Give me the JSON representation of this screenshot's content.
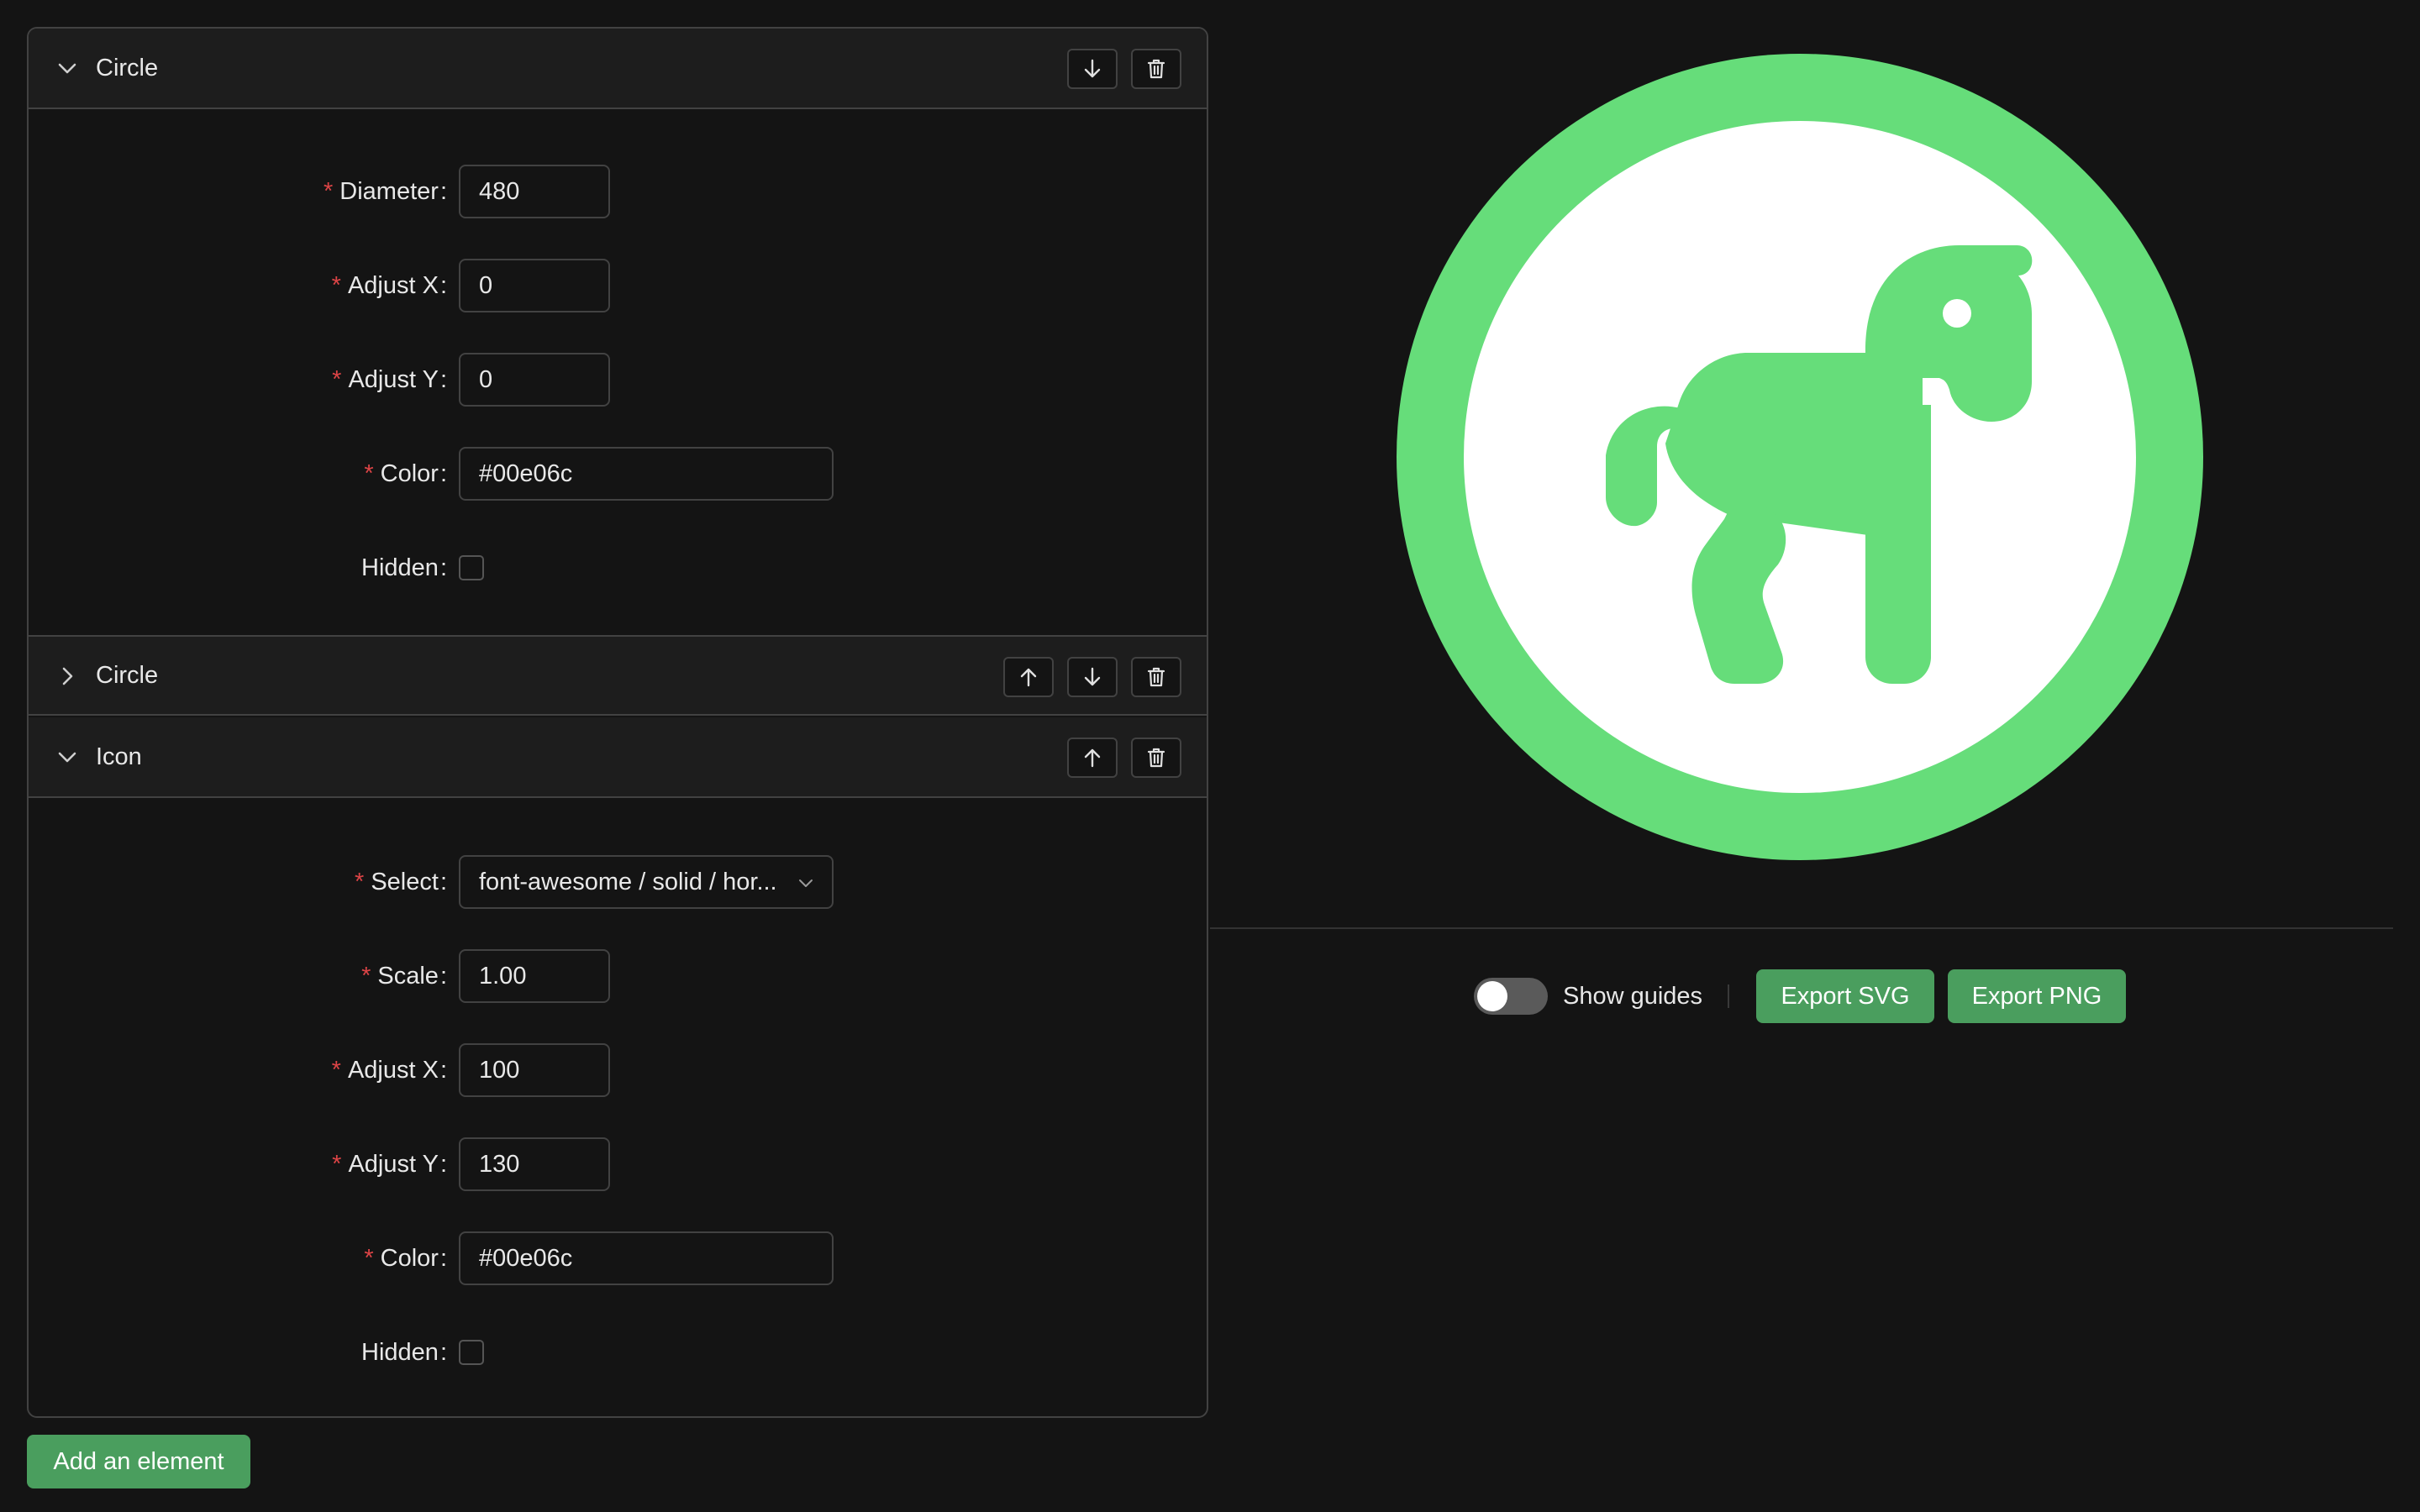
{
  "elements": [
    {
      "title": "Circle",
      "expanded": true,
      "fields": [
        {
          "label": "Diameter",
          "required": true,
          "value": "480"
        },
        {
          "label": "Adjust X",
          "required": true,
          "value": "0"
        },
        {
          "label": "Adjust Y",
          "required": true,
          "value": "0"
        },
        {
          "label": "Color",
          "required": true,
          "value": "#00e06c"
        },
        {
          "label": "Hidden",
          "required": false,
          "checked": false
        }
      ]
    },
    {
      "title": "Circle",
      "expanded": false
    },
    {
      "title": "Icon",
      "expanded": true,
      "fields": [
        {
          "label": "Select",
          "required": true,
          "value": "font-awesome / solid / hor..."
        },
        {
          "label": "Scale",
          "required": true,
          "value": "1.00"
        },
        {
          "label": "Adjust X",
          "required": true,
          "value": "100"
        },
        {
          "label": "Adjust Y",
          "required": true,
          "value": "130"
        },
        {
          "label": "Color",
          "required": true,
          "value": "#00e06c"
        },
        {
          "label": "Hidden",
          "required": false,
          "checked": false
        }
      ]
    }
  ],
  "add_element_label": "Add an element",
  "preview": {
    "icon": "horse-icon",
    "ring_color": "#66dd7a",
    "inner_color": "#ffffff"
  },
  "toolbar": {
    "show_guides_label": "Show guides",
    "show_guides_on": false,
    "export_svg_label": "Export SVG",
    "export_png_label": "Export PNG"
  },
  "colors": {
    "background": "#141414",
    "accent_button": "#4a9e5e",
    "required_mark": "#dc4446"
  }
}
